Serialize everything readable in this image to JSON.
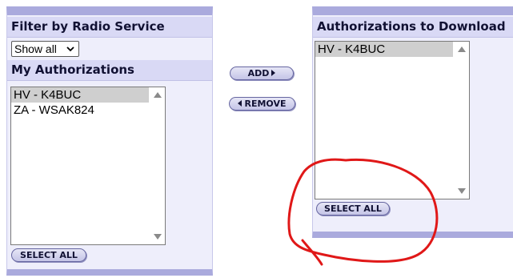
{
  "filter_panel": {
    "title": "Filter by Radio Service",
    "filter_select": {
      "selected": "Show all"
    }
  },
  "my_authorizations": {
    "title": "My Authorizations",
    "items": [
      {
        "label": "HV - K4BUC",
        "selected": true
      },
      {
        "label": "ZA - WSAK824",
        "selected": false
      }
    ],
    "select_all_label": "SELECT ALL"
  },
  "transfer": {
    "add_label": "ADD",
    "remove_label": "REMOVE"
  },
  "download_panel": {
    "title": "Authorizations to Download",
    "items": [
      {
        "label": "HV - K4BUC",
        "selected": true
      }
    ],
    "select_all_label": "SELECT ALL"
  },
  "colors": {
    "panel_background": "#eeeefb",
    "panel_header": "#d9d9f5",
    "panel_border": "#aaaadd",
    "annotation": "#e01818"
  }
}
